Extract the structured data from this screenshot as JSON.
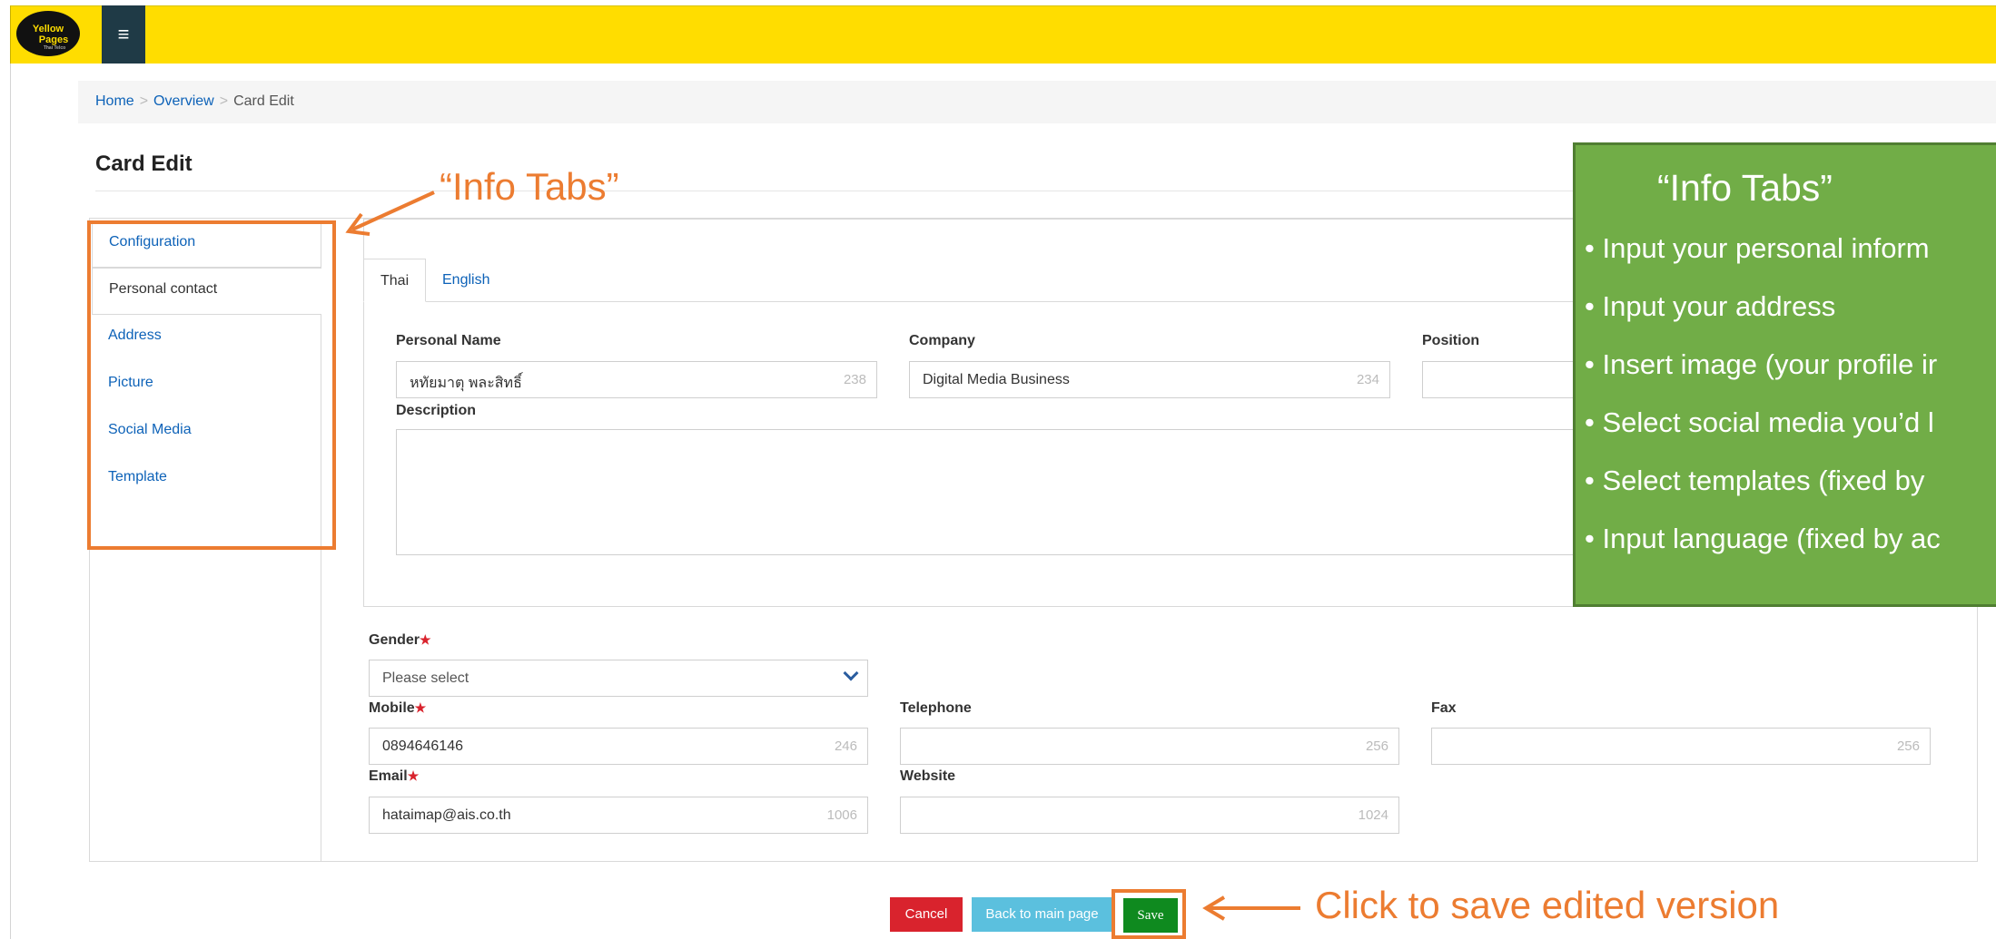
{
  "header": {
    "logo_text_line1": "Yellow",
    "logo_text_line2": "Pages",
    "logo_text_line3": "Thai Telco",
    "menu_icon": "hamburger-icon"
  },
  "breadcrumb": {
    "items": [
      "Home",
      "Overview",
      "Card Edit"
    ],
    "separator": ">"
  },
  "page": {
    "title": "Card Edit"
  },
  "side_tabs": [
    {
      "label": "Configuration"
    },
    {
      "label": "Personal contact"
    },
    {
      "label": "Address"
    },
    {
      "label": "Picture"
    },
    {
      "label": "Social Media"
    },
    {
      "label": "Template"
    }
  ],
  "lang_tabs": [
    {
      "label": "Thai"
    },
    {
      "label": "English"
    }
  ],
  "form": {
    "personal_name": {
      "label": "Personal Name",
      "value": "หทัยมาตุ พละสิทธิ์",
      "counter": "238"
    },
    "company": {
      "label": "Company",
      "value": "Digital Media Business",
      "counter": "234"
    },
    "position": {
      "label": "Position",
      "value": ""
    },
    "description": {
      "label": "Description",
      "value": ""
    },
    "gender": {
      "label": "Gender",
      "required_mark": "★",
      "selected": "Please select"
    },
    "mobile": {
      "label": "Mobile",
      "required_mark": "★",
      "value": "0894646146",
      "counter": "246"
    },
    "telephone": {
      "label": "Telephone",
      "value": "",
      "counter": "256"
    },
    "fax": {
      "label": "Fax",
      "value": "",
      "counter": "256"
    },
    "email": {
      "label": "Email",
      "required_mark": "★",
      "value": "hataimap@ais.co.th",
      "counter": "1006"
    },
    "website": {
      "label": "Website",
      "value": "",
      "counter": "1024"
    }
  },
  "buttons": {
    "cancel": "Cancel",
    "back": "Back to main page",
    "save": "Save"
  },
  "annotations": {
    "info_tabs_label": "“Info Tabs”",
    "save_hint": "Click to save edited version",
    "green_box": {
      "title": "“Info Tabs”",
      "items": [
        "• Input your personal inform",
        "• Input your address",
        "• Insert image (your profile ir",
        "• Select social media you’d l",
        "• Select templates (fixed by",
        "• Input language (fixed by ac"
      ]
    }
  },
  "colors": {
    "header_bg": "#ffdd00",
    "link": "#0d62b8",
    "annotation": "#ec7c31",
    "annotation_box": "#71ad47",
    "cancel": "#d9232d",
    "back": "#5bc0de",
    "save": "#0f8a1f"
  }
}
